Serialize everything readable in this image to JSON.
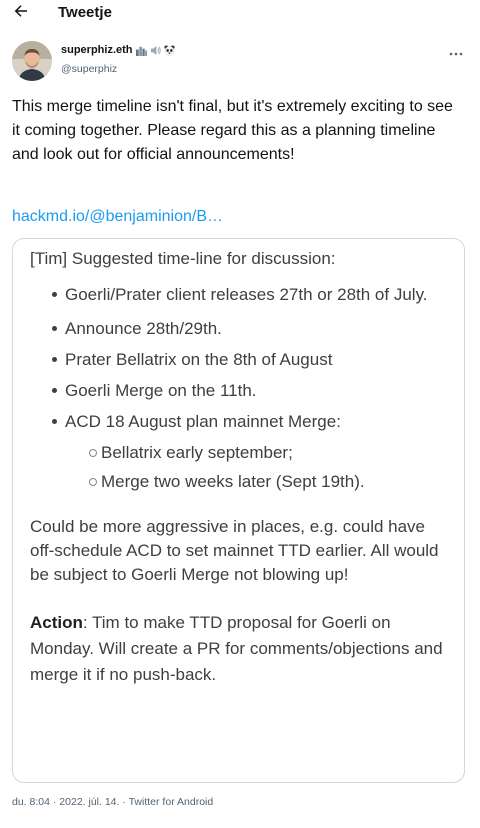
{
  "header": {
    "title": "Tweetje",
    "back_icon": "arrow-left-icon"
  },
  "author": {
    "display_name": "superphiz.eth",
    "emojis": [
      "cityscape-icon",
      "speaker-icon",
      "panda-icon"
    ],
    "handle": "@superphiz",
    "more_icon": "more-horizontal-icon"
  },
  "tweet": {
    "text": "This merge timeline isn't final, but it's extremely exciting to see it coming together. Please regard this as a planning timeline and look out for official announcements!",
    "link": "hackmd.io/@benjaminion/B…"
  },
  "card": {
    "heading": "[Tim] Suggested time-line for discussion:",
    "bullets": [
      "Goerli/Prater client releases 27th or 28th of July.",
      "Announce 28th/29th.",
      "Prater Bellatrix on the 8th of August",
      "Goerli Merge on the 11th.",
      "ACD 18 August plan mainnet Merge:"
    ],
    "sub_bullets": [
      "Bellatrix early september;",
      "Merge two weeks later (Sept 19th)."
    ],
    "paragraph": "Could be more aggressive in places, e.g. could have off-schedule ACD to set mainnet TTD earlier. All would be subject to Goerli Merge not blowing up!",
    "action_label": "Action",
    "action_text": ": Tim to make TTD proposal for Goerli on Monday. Will create a PR for comments/objections and merge it if no push-back."
  },
  "meta": {
    "time": "du. 8:04",
    "separator": " · ",
    "date": "2022. júl. 14.",
    "client": "Twitter for Android"
  },
  "colors": {
    "link": "#1d9bf0",
    "text": "#0f1419",
    "secondary": "#536471",
    "border": "#cfd9de"
  }
}
